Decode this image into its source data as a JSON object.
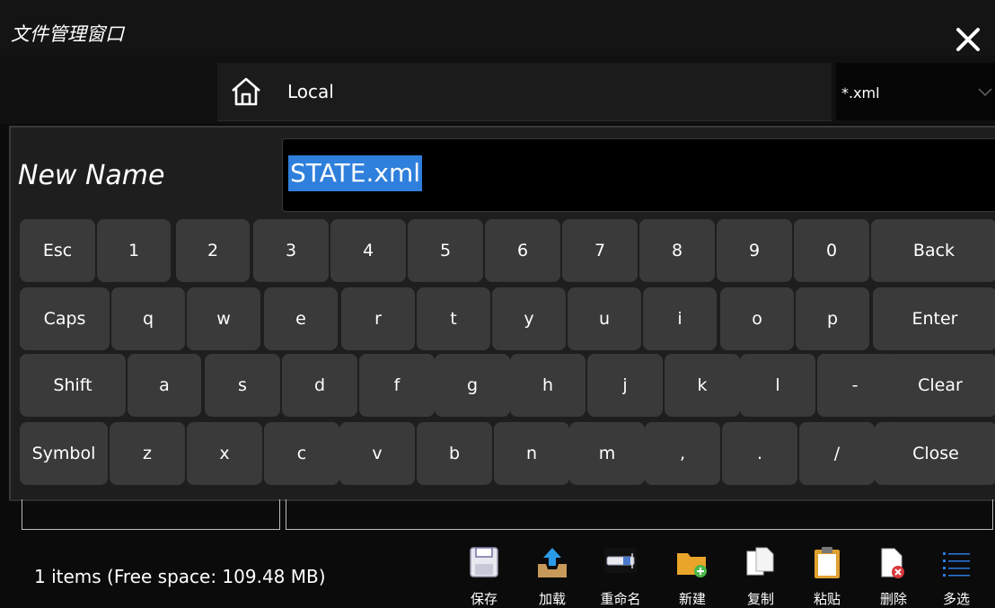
{
  "window": {
    "title": "文件管理窗口"
  },
  "nav": {
    "path": "Local",
    "filter": "*.xml"
  },
  "dialog": {
    "label": "New Name",
    "value": "STATE.xml"
  },
  "keyboard": {
    "rows": [
      [
        "Esc",
        "1",
        "2",
        "3",
        "4",
        "5",
        "6",
        "7",
        "8",
        "9",
        "0",
        "Back"
      ],
      [
        "Caps",
        "q",
        "w",
        "e",
        "r",
        "t",
        "y",
        "u",
        "i",
        "o",
        "p",
        "Enter"
      ],
      [
        "Shift",
        "a",
        "s",
        "d",
        "f",
        "g",
        "h",
        "j",
        "k",
        "l",
        "-",
        "Clear"
      ],
      [
        "Symbol",
        "z",
        "x",
        "c",
        "v",
        "b",
        "n",
        "m",
        ",",
        ".",
        "/",
        "Close"
      ]
    ]
  },
  "status": {
    "text": "1 items (Free space: 109.48 MB)"
  },
  "toolbar": {
    "save": "保存",
    "load": "加载",
    "rename": "重命名",
    "new": "新建",
    "copy": "复制",
    "paste": "粘贴",
    "delete": "删除",
    "multi": "多选"
  },
  "icons": [
    "close-icon",
    "back-arrow-icon",
    "forward-arrow-icon",
    "up-arrow-icon",
    "home-icon",
    "chevron-down-icon",
    "save-icon",
    "load-icon",
    "rename-icon",
    "new-folder-icon",
    "copy-icon",
    "paste-icon",
    "delete-icon",
    "multi-select-icon"
  ]
}
